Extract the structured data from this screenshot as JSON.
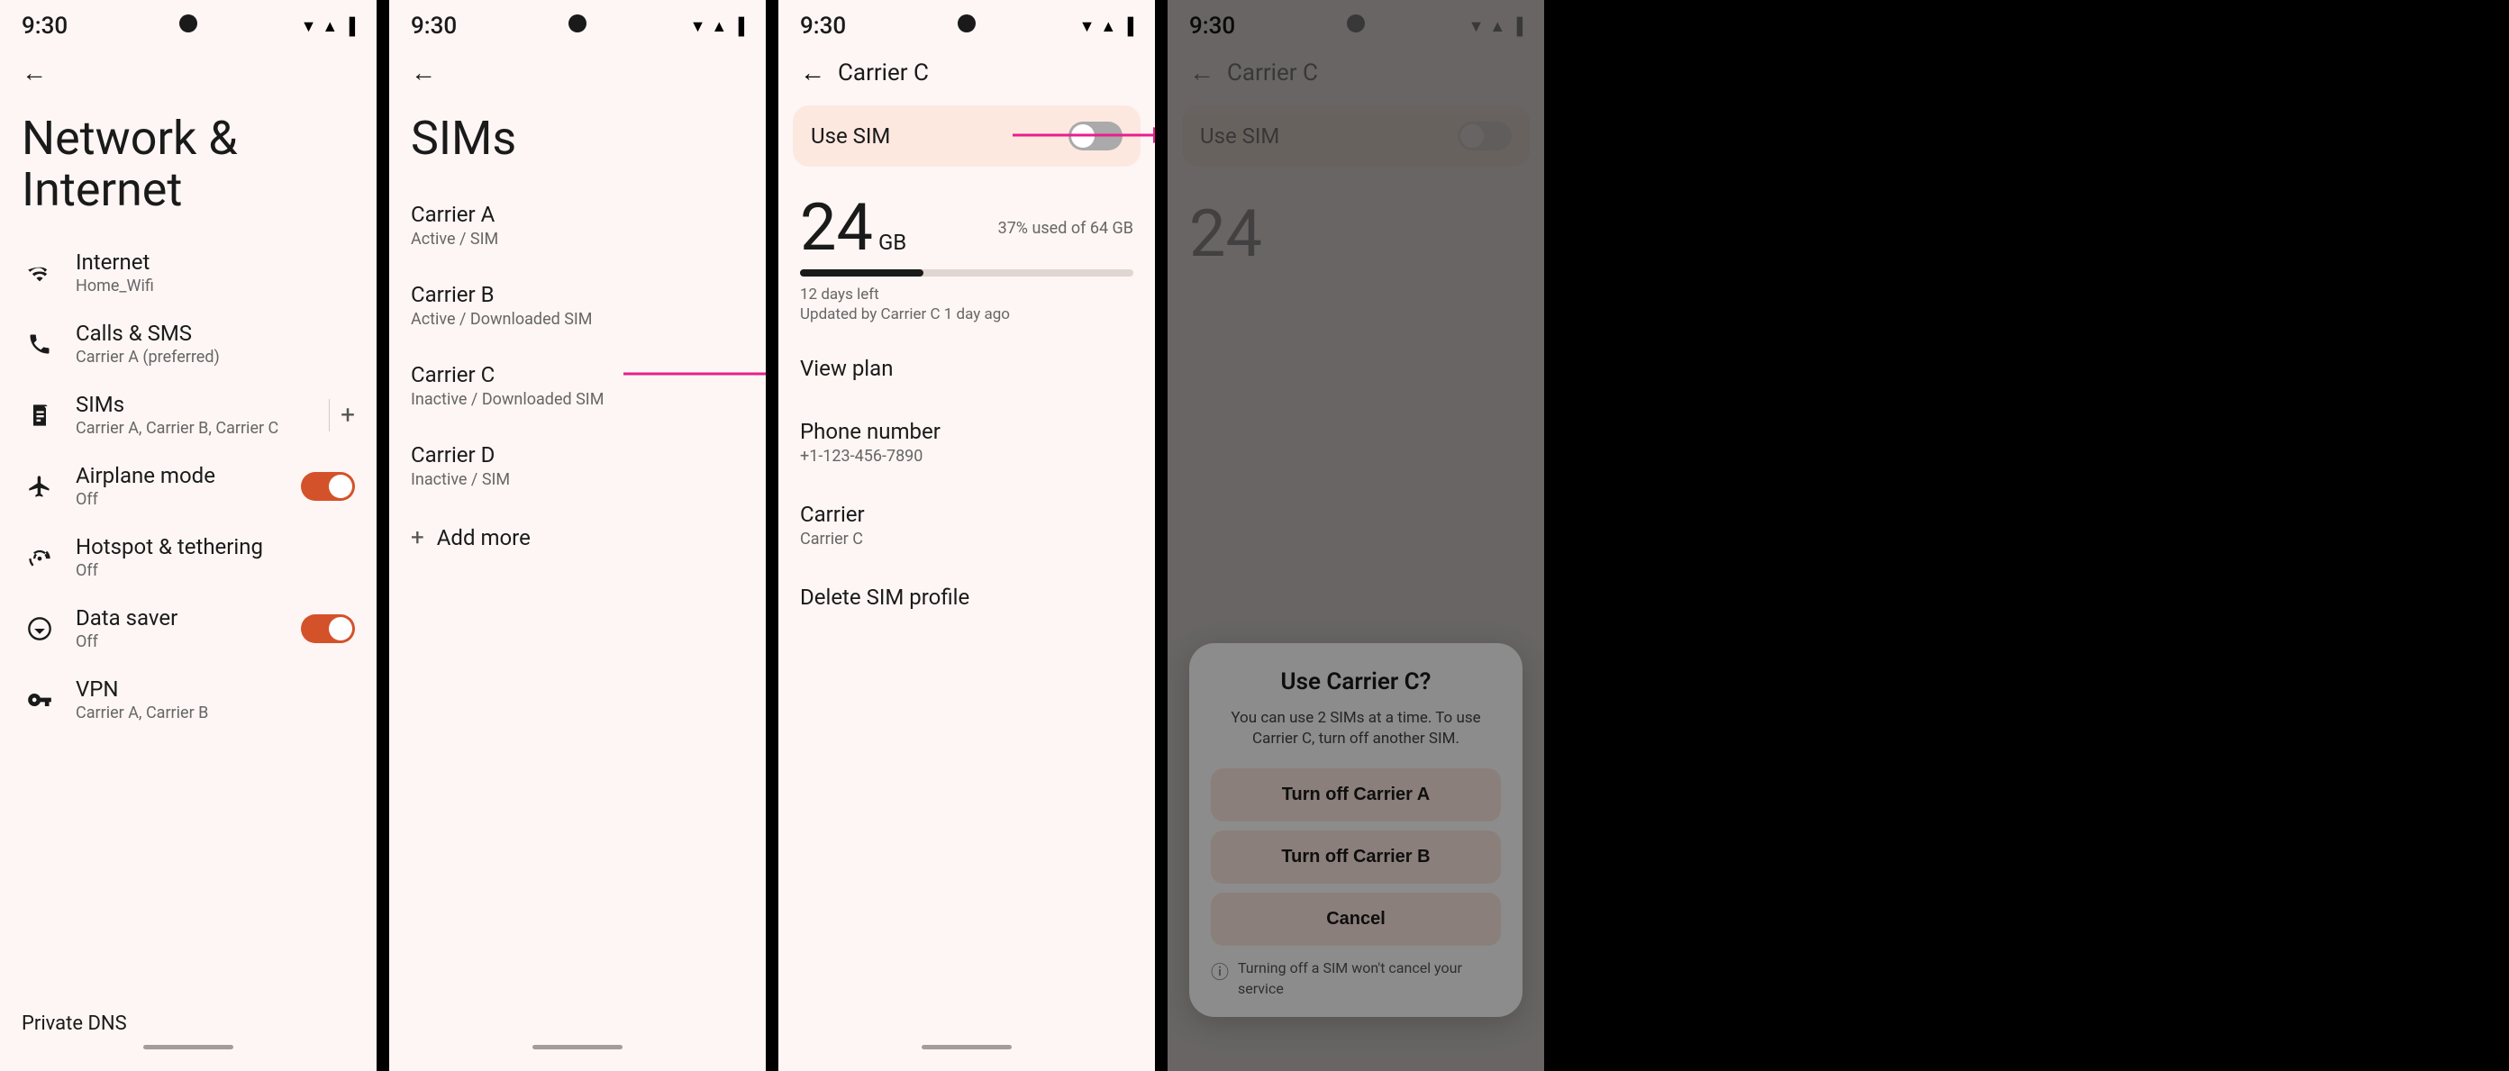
{
  "panels": {
    "panel1": {
      "statusTime": "9:30",
      "title": "Network & Internet",
      "menuItems": [
        {
          "icon": "wifi",
          "label": "Internet",
          "sublabel": "Home_Wifi"
        },
        {
          "icon": "phone",
          "label": "Calls & SMS",
          "sublabel": "Carrier A (preferred)"
        },
        {
          "icon": "sim",
          "label": "SIMs",
          "sublabel": "Carrier A, Carrier B, Carrier C",
          "hasAdd": true
        },
        {
          "icon": "plane",
          "label": "Airplane mode",
          "sublabel": "Off",
          "toggle": "on"
        },
        {
          "icon": "hotspot",
          "label": "Hotspot & tethering",
          "sublabel": "Off"
        },
        {
          "icon": "saver",
          "label": "Data saver",
          "sublabel": "Off",
          "toggle": "on"
        },
        {
          "icon": "vpn",
          "label": "VPN",
          "sublabel": "Carrier A, Carrier B"
        }
      ],
      "bottomLabel": "Private DNS"
    },
    "panel2": {
      "statusTime": "9:30",
      "title": "SIMs",
      "sims": [
        {
          "name": "Carrier A",
          "status": "Active / SIM"
        },
        {
          "name": "Carrier B",
          "status": "Active / Downloaded SIM"
        },
        {
          "name": "Carrier C",
          "status": "Inactive / Downloaded SIM"
        },
        {
          "name": "Carrier D",
          "status": "Inactive / SIM"
        }
      ],
      "addMoreLabel": "Add more"
    },
    "panel3": {
      "statusTime": "9:30",
      "backLabel": "",
      "pageTitle": "Carrier C",
      "useSimLabel": "Use SIM",
      "dataAmount": "24",
      "dataUnit": "GB",
      "dataUsedLabel": "37% used of 64 GB",
      "progressPct": 37,
      "daysLeft": "12 days left",
      "updatedLabel": "Updated by Carrier C 1 day ago",
      "details": [
        {
          "label": "View plan"
        },
        {
          "label": "Phone number",
          "value": "+1-123-456-7890"
        },
        {
          "label": "Carrier",
          "value": "Carrier C"
        },
        {
          "label": "Delete SIM profile"
        }
      ]
    },
    "panel4": {
      "statusTime": "9:30",
      "pageTitle": "Carrier C",
      "useSimLabel": "Use SIM",
      "dataAmount": "24",
      "dialog": {
        "title": "Use Carrier C?",
        "body": "You can use 2 SIMs at a time. To use Carrier C, turn off another SIM.",
        "btn1": "Turn off Carrier A",
        "btn2": "Turn off Carrier B",
        "btn3": "Cancel",
        "notice": "Turning off a SIM won't cancel your service"
      }
    }
  },
  "icons": {
    "wifi": "📶",
    "phone": "📞",
    "sim": "📱",
    "plane": "✈",
    "hotspot": "📡",
    "saver": "💾",
    "vpn": "🔑",
    "back": "←",
    "add": "+",
    "info": "ⓘ"
  }
}
